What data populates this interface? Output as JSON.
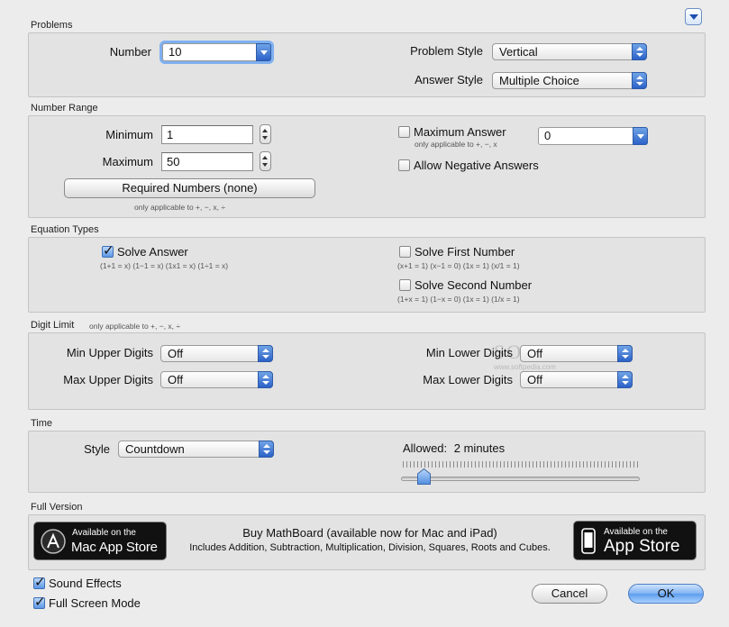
{
  "problems": {
    "section_title": "Problems",
    "number_label": "Number",
    "number_value": "10",
    "problem_style_label": "Problem Style",
    "problem_style_value": "Vertical",
    "answer_style_label": "Answer Style",
    "answer_style_value": "Multiple Choice"
  },
  "number_range": {
    "section_title": "Number Range",
    "minimum_label": "Minimum",
    "minimum_value": "1",
    "maximum_label": "Maximum",
    "maximum_value": "50",
    "required_numbers_label": "Required Numbers (none)",
    "required_note": "only applicable to +, −, x, ÷",
    "max_answer_label": "Maximum Answer",
    "max_answer_checked": false,
    "max_answer_note": "only applicable to +, −, x",
    "max_answer_value": "0",
    "allow_negative_label": "Allow Negative Answers",
    "allow_negative_checked": false
  },
  "equation_types": {
    "section_title": "Equation Types",
    "solve_answer_label": "Solve Answer",
    "solve_answer_checked": true,
    "solve_answer_example": "(1+1 = x) (1−1 = x) (1x1 = x) (1÷1 = x)",
    "solve_first_label": "Solve First Number",
    "solve_first_checked": false,
    "solve_first_example": "(x+1 = 1) (x−1 = 0) (1x = 1) (x/1 = 1)",
    "solve_second_label": "Solve Second Number",
    "solve_second_checked": false,
    "solve_second_example": "(1+x = 1) (1−x = 0) (1x = 1) (1/x = 1)"
  },
  "digit_limit": {
    "section_title": "Digit Limit",
    "section_note": "only applicable to +, −, x, ÷",
    "min_upper_label": "Min Upper Digits",
    "min_upper_value": "Off",
    "max_upper_label": "Max Upper Digits",
    "max_upper_value": "Off",
    "min_lower_label": "Min Lower Digits",
    "min_lower_value": "Off",
    "max_lower_label": "Max Lower Digits",
    "max_lower_value": "Off"
  },
  "time": {
    "section_title": "Time",
    "style_label": "Style",
    "style_value": "Countdown",
    "allowed_label": "Allowed:",
    "allowed_value": "2 minutes",
    "slider_fraction": 0.07
  },
  "full_version": {
    "section_title": "Full Version",
    "mac_badge_small": "Available on the",
    "mac_badge_big": "Mac App Store",
    "ios_badge_small": "Available on the",
    "ios_badge_big": "App Store",
    "promo_title": "Buy MathBoard (available now for Mac and iPad)",
    "promo_subtitle": "Includes Addition, Subtraction, Multiplication, Division, Squares, Roots and Cubes."
  },
  "footer": {
    "sound_effects_label": "Sound Effects",
    "sound_effects_checked": true,
    "full_screen_label": "Full Screen Mode",
    "full_screen_checked": true,
    "cancel_label": "Cancel",
    "ok_label": "OK"
  },
  "watermark": {
    "brand": "SOFTPEDIA",
    "url": "www.softpedia.com"
  }
}
